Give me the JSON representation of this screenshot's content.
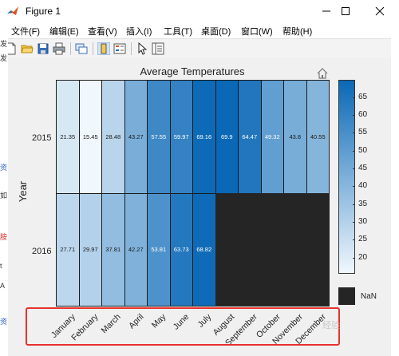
{
  "window": {
    "title": "Figure 1",
    "controls": [
      "minimize",
      "maximize",
      "close"
    ]
  },
  "menu": {
    "items": [
      "文件(F)",
      "编辑(E)",
      "查看(V)",
      "插入(I)",
      "工具(T)",
      "桌面(D)",
      "窗口(W)",
      "帮助(H)"
    ]
  },
  "toolbar": {
    "icons": [
      "new-figure-icon",
      "open-icon",
      "save-icon",
      "print-icon",
      "link-icon",
      "colorbar-icon",
      "legend-icon",
      "pointer-icon",
      "property-editor-icon"
    ]
  },
  "left_strip_text": [
    "发",
    "发",
    "资",
    "如",
    "胺",
    "t",
    "A",
    "资"
  ],
  "chart_data": {
    "type": "heatmap",
    "title": "Average Temperatures",
    "ylabel": "Year",
    "xlabel": "",
    "rows": [
      "2015",
      "2016"
    ],
    "columns": [
      "January",
      "February",
      "March",
      "April",
      "May",
      "June",
      "July",
      "August",
      "September",
      "October",
      "November",
      "December"
    ],
    "values": [
      [
        21.35,
        15.45,
        28.48,
        43.27,
        57.55,
        59.97,
        69.16,
        69.9,
        64.47,
        49.32,
        43.8,
        40.55
      ],
      [
        27.71,
        29.97,
        37.81,
        42.27,
        53.81,
        63.73,
        68.82,
        null,
        null,
        null,
        null,
        null
      ]
    ],
    "value_labels": [
      [
        "21.35",
        "15.45",
        "28.48",
        "43.27",
        "57.55",
        "59.97",
        "69.16",
        "69.9",
        "64.47",
        "49.32",
        "43.8",
        "40.55"
      ],
      [
        "27.71",
        "29.97",
        "37.81",
        "42.27",
        "53.81",
        "63.73",
        "68.82",
        "",
        "",
        "",
        "",
        ""
      ]
    ],
    "colorbar": {
      "ticks": [
        "65",
        "60",
        "55",
        "50",
        "45",
        "40",
        "35",
        "30",
        "25",
        "20"
      ],
      "range": [
        15.45,
        69.9
      ],
      "missing_label": "NaN"
    },
    "colormap": {
      "low": "#f0f7fd",
      "high": "#0a68b6",
      "missing": "#252525"
    }
  },
  "watermark": "经验"
}
